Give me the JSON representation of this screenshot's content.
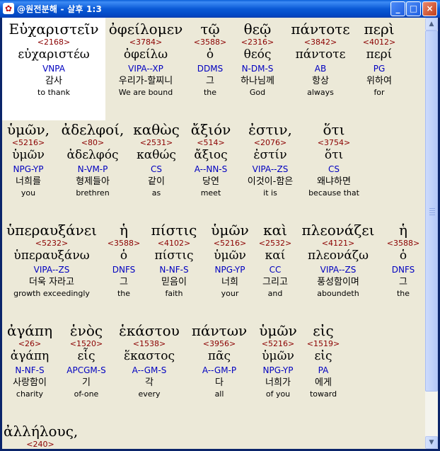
{
  "window": {
    "title": "@원전분해 - 살후 1:3",
    "app_icon": "app-icon",
    "buttons": {
      "minimize": "_",
      "maximize": "□",
      "close": "×"
    }
  },
  "colors": {
    "number": "#8b0000",
    "parsing": "#0000c0",
    "highlight": "#ffffff",
    "background": "#ece9d8"
  },
  "rows": [
    {
      "words": [
        {
          "greek": "Εὐχαριστεῖν",
          "strong": "<2168>",
          "lemma": "εὐχαριστέω",
          "parsing": "VNPA",
          "korean": "감사",
          "english": "to thank",
          "highlighted": true
        },
        {
          "greek": "ὀφείλομεν",
          "strong": "<3784>",
          "lemma": "ὀφείλω",
          "parsing": "VIPA--XP",
          "korean": "우리가-할찌니",
          "english": "We are bound"
        },
        {
          "greek": "τῷ",
          "strong": "<3588>",
          "lemma": "ὁ",
          "parsing": "DDMS",
          "korean": "그",
          "english": "the"
        },
        {
          "greek": "θεῷ",
          "strong": "<2316>",
          "lemma": "θεός",
          "parsing": "N-DM-S",
          "korean": "하나님께",
          "english": "God"
        },
        {
          "greek": "πάντοτε",
          "strong": "<3842>",
          "lemma": "πάντοτε",
          "parsing": "AB",
          "korean": "항상",
          "english": "always"
        },
        {
          "greek": "περὶ",
          "strong": "<4012>",
          "lemma": "περί",
          "parsing": "PG",
          "korean": "위하여",
          "english": "for"
        }
      ]
    },
    {
      "words": [
        {
          "greek": "ὑμῶν,",
          "strong": "<5216>",
          "lemma": "ὑμῶν",
          "parsing": "NPG-YP",
          "korean": "너희를",
          "english": "you"
        },
        {
          "greek": "ἀδελφοί,",
          "strong": "<80>",
          "lemma": "ἀδελφός",
          "parsing": "N-VM-P",
          "korean": "형제들아",
          "english": "brethren"
        },
        {
          "greek": "καθὼς",
          "strong": "<2531>",
          "lemma": "καθώς",
          "parsing": "CS",
          "korean": "같이",
          "english": "as"
        },
        {
          "greek": "ἄξιόν",
          "strong": "<514>",
          "lemma": "ἄξιος",
          "parsing": "A--NN-S",
          "korean": "당연",
          "english": "meet"
        },
        {
          "greek": "ἐστιν,",
          "strong": "<2076>",
          "lemma": "ἐστίν",
          "parsing": "VIPA--ZS",
          "korean": "이것이-함은",
          "english": "it is"
        },
        {
          "greek": "ὅτι",
          "strong": "<3754>",
          "lemma": "ὅτι",
          "parsing": "CS",
          "korean": "왜냐하면",
          "english": "because that"
        }
      ]
    },
    {
      "words": [
        {
          "greek": "ὑπεραυξάνει",
          "strong": "<5232>",
          "lemma": "ὑπεραυξάνω",
          "parsing": "VIPA--ZS",
          "korean": "더욱 자라고",
          "english": "growth exceedingly"
        },
        {
          "greek": "ἡ",
          "strong": "<3588>",
          "lemma": "ὁ",
          "parsing": "DNFS",
          "korean": "그",
          "english": "the"
        },
        {
          "greek": "πίστις",
          "strong": "<4102>",
          "lemma": "πίστις",
          "parsing": "N-NF-S",
          "korean": "믿음이",
          "english": "faith"
        },
        {
          "greek": "ὑμῶν",
          "strong": "<5216>",
          "lemma": "ὑμῶν",
          "parsing": "NPG-YP",
          "korean": "너희",
          "english": "your"
        },
        {
          "greek": "καὶ",
          "strong": "<2532>",
          "lemma": "καί",
          "parsing": "CC",
          "korean": "그리고",
          "english": "and"
        },
        {
          "greek": "πλεονάζει",
          "strong": "<4121>",
          "lemma": "πλεονάζω",
          "parsing": "VIPA--ZS",
          "korean": "풍성함이며",
          "english": "aboundeth"
        },
        {
          "greek": "ἡ",
          "strong": "<3588>",
          "lemma": "ὁ",
          "parsing": "DNFS",
          "korean": "그",
          "english": "the"
        }
      ]
    },
    {
      "words": [
        {
          "greek": "ἀγάπη",
          "strong": "<26>",
          "lemma": "ἀγάπη",
          "parsing": "N-NF-S",
          "korean": "사랑함이",
          "english": "charity"
        },
        {
          "greek": "ἑνὸς",
          "strong": "<1520>",
          "lemma": "εἷς",
          "parsing": "APCGM-S",
          "korean": "기",
          "english": "of-one"
        },
        {
          "greek": "ἑκάστου",
          "strong": "<1538>",
          "lemma": "ἕκαστος",
          "parsing": "A--GM-S",
          "korean": "각",
          "english": "every"
        },
        {
          "greek": "πάντων",
          "strong": "<3956>",
          "lemma": "πᾶς",
          "parsing": "A--GM-P",
          "korean": "다",
          "english": "all"
        },
        {
          "greek": "ὑμῶν",
          "strong": "<5216>",
          "lemma": "ὑμῶν",
          "parsing": "NPG-YP",
          "korean": "너희가",
          "english": "of you"
        },
        {
          "greek": "εἰς",
          "strong": "<1519>",
          "lemma": "εἰς",
          "parsing": "PA",
          "korean": "에게",
          "english": "toward"
        }
      ]
    },
    {
      "words": [
        {
          "greek": "ἀλλήλους,",
          "strong": "<240>"
        }
      ]
    }
  ]
}
